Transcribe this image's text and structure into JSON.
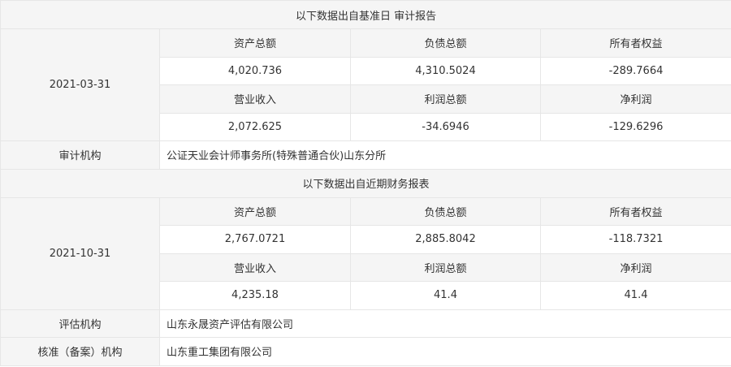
{
  "sections": [
    {
      "header": "以下数据出自基准日 审计报告",
      "date": "2021-03-31",
      "row1_labels": [
        "资产总额",
        "负债总额",
        "所有者权益"
      ],
      "row1_values": [
        "4,020.736",
        "4,310.5024",
        "-289.7664"
      ],
      "row2_labels": [
        "营业收入",
        "利润总额",
        "净利润"
      ],
      "row2_values": [
        "2,072.625",
        "-34.6946",
        "-129.6296"
      ],
      "org_label": "审计机构",
      "org_value": "公证天业会计师事务所(特殊普通合伙)山东分所"
    },
    {
      "header": "以下数据出自近期财务报表",
      "date": "2021-10-31",
      "row1_labels": [
        "资产总额",
        "负债总额",
        "所有者权益"
      ],
      "row1_values": [
        "2,767.0721",
        "2,885.8042",
        "-118.7321"
      ],
      "row2_labels": [
        "营业收入",
        "利润总额",
        "净利润"
      ],
      "row2_values": [
        "4,235.18",
        "41.4",
        "41.4"
      ],
      "org_label": "评估机构",
      "org_value": "山东永晟资产评估有限公司"
    }
  ],
  "approval": {
    "label": "核准（备案）机构",
    "value": "山东重工集团有限公司"
  }
}
